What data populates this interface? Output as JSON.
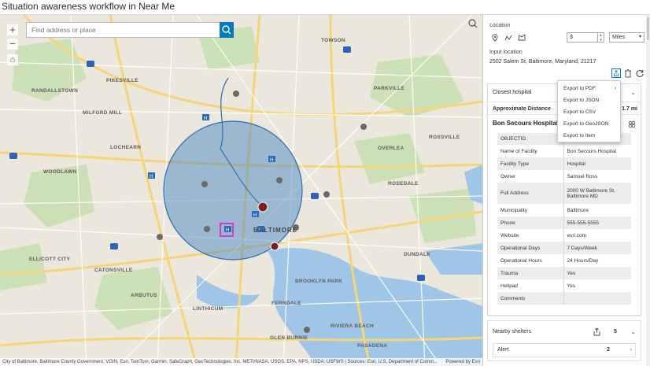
{
  "app": {
    "title": "Situation awareness workflow in Near Me"
  },
  "map": {
    "search_placeholder": "Find address or place",
    "zoom_in": "+",
    "zoom_out": "−",
    "home": "⌂",
    "attribution": "City of Baltimore, Baltimore County Government, VGIN, Esri, TomTom, Garmin, SafeGraph, GeoTechnologies, Inc, METI/NASA, USGS, EPA, NPS, USDA, USFWS | Sources: Esri, U.S. Department of Comm...",
    "powered_by": "Powered by Esri",
    "labels": [
      "PIKESVILLE",
      "RANDALLSTOWN",
      "MILFORD MILL",
      "LOCHEARN",
      "WOODLAWN",
      "TOWSON",
      "PARKVILLE",
      "OVERLEA",
      "ROSSVILLE",
      "ROSEDALE",
      "BALTIMORE",
      "ELLICOTT CITY",
      "CATONSVILLE",
      "ARBUTUS",
      "DUNDALK",
      "GLEN BURNIE",
      "FERNDALE",
      "PASADENA",
      "RIVIERA BEACH",
      "LINTHICUM",
      "BROOKLYN PARK"
    ],
    "accent": "#007ac2",
    "buffer_color": "#3a7fc1"
  },
  "panel": {
    "location_label": "Location",
    "distance_value": "3",
    "distance_unit": "Miles",
    "stepper_up": "▲",
    "stepper_down": "▼",
    "input_location_label": "Input location",
    "address": "2502 Salem St, Baltimore, Maryland, 21217",
    "closest_card": {
      "header": "Closest hospital",
      "approx_label": "Approximate Distance",
      "approx_value": "1.7 mi",
      "facility_title": "Bon Secours Hospital",
      "attributes": [
        {
          "key": "OBJECTID",
          "value": ""
        },
        {
          "key": "Name of Facility",
          "value": "Bon Secours Hospital"
        },
        {
          "key": "Facility Type",
          "value": "Hospital"
        },
        {
          "key": "Owner",
          "value": "Samuel Ross"
        },
        {
          "key": "Full Address",
          "value": "2000 W Baltimore St, Baltimore MD"
        },
        {
          "key": "Municipality",
          "value": "Baltimore"
        },
        {
          "key": "Phone",
          "value": "555-555-5555"
        },
        {
          "key": "Website",
          "value": "esri.com"
        },
        {
          "key": "Operational Days",
          "value": "7 Days/Week"
        },
        {
          "key": "Operational Hours",
          "value": "24 Hours/Day"
        },
        {
          "key": "Trauma",
          "value": "Yes"
        },
        {
          "key": "Helipad",
          "value": "Yes"
        },
        {
          "key": "Comments",
          "value": ""
        }
      ]
    },
    "shelters": {
      "title": "Nearby shelters",
      "count": "5",
      "alert_label": "Alert",
      "alert_count": "2"
    }
  },
  "export_menu": {
    "items": [
      "Export to PDF",
      "Export to JSON",
      "Export to CSV",
      "Export to GeoJSON",
      "Export to Item"
    ],
    "submenu_arrow": "›"
  }
}
